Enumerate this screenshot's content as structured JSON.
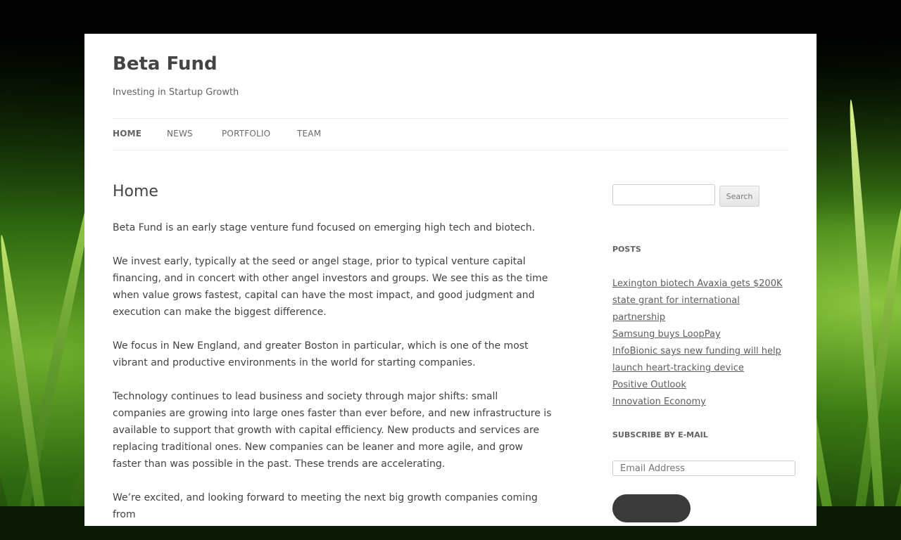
{
  "site": {
    "title": "Beta Fund",
    "tagline": "Investing in Startup Growth"
  },
  "nav": {
    "items": [
      {
        "label": "HOME",
        "active": true
      },
      {
        "label": "NEWS",
        "active": false
      },
      {
        "label": "PORTFOLIO",
        "active": false
      },
      {
        "label": "TEAM",
        "active": false
      }
    ]
  },
  "page": {
    "title": "Home",
    "paragraphs": [
      "Beta Fund is an early stage venture fund focused on emerging high tech and biotech.",
      "We invest early, typically at the seed or angel stage, prior to typical venture capital financing, and in concert with other angel investors and groups.  We see this as the time when value grows fastest, capital can have the most impact, and good judgment and execution can make the biggest difference.",
      "We focus in New England, and greater Boston in particular, which is one of the most vibrant and productive environments in the world for starting companies.",
      "Technology continues to lead business and society through major shifts: small companies are growing into large ones faster than ever before, and new infrastructure is available to support that growth with capital efficiency. New products and services are replacing traditional ones. New companies can be leaner and more agile, and grow faster than was possible in the past. These trends are accelerating.",
      "We’re excited, and looking forward to meeting the next big growth companies coming from"
    ]
  },
  "sidebar": {
    "search": {
      "value": "",
      "button_label": "Search"
    },
    "posts": {
      "title": "POSTS",
      "items": [
        "Lexington biotech Avaxia gets $200K state grant for international partnership",
        "Samsung buys LoopPay",
        "InfoBionic says new funding will help launch heart-tracking device",
        "Positive Outlook",
        "Innovation Economy"
      ]
    },
    "subscribe": {
      "title": "SUBSCRIBE BY E-MAIL",
      "placeholder": "Email Address"
    }
  },
  "colors": {
    "text": "#444444",
    "link": "#5e5e5e",
    "button_dark": "#3a3a3a",
    "background_grass": "#3d7d14"
  }
}
